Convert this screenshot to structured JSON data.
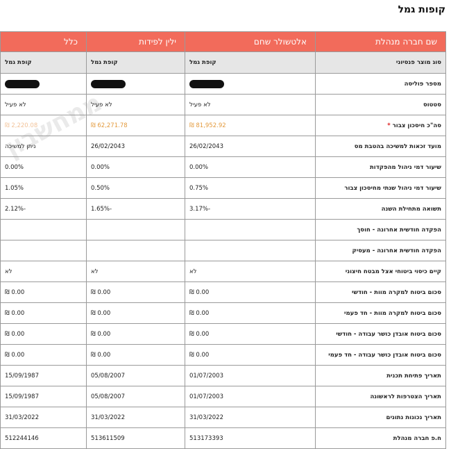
{
  "page_title": "קופות גמל",
  "header": {
    "label_col": "שם חברה מנהלת",
    "col1": "אלטשולר שחם",
    "col2": "ילין לפידות",
    "col3": "כלל"
  },
  "rows": [
    {
      "label": "סוג מוצר פנסיוני",
      "v1": "קופת גמל",
      "v2": "קופת גמל",
      "v3": "קופת גמל"
    },
    {
      "label": "מספר פוליסה",
      "v1": "",
      "v2": "",
      "v3": ""
    },
    {
      "label": "סטטוס",
      "v1": "לא פעיל",
      "v2": "לא פעיל",
      "v3": "לא פעיל"
    },
    {
      "label": "סה\"כ חיסכון צבור",
      "asterisk": "*",
      "v1": "81,952.92 ₪",
      "v2": "62,271.78 ₪",
      "v3": "2,220.08 ₪"
    },
    {
      "label": "מועד זכאות למשיכה בהטבת מס",
      "v1": "26/02/2043",
      "v2": "26/02/2043",
      "v3": "ניתן למשיכה"
    },
    {
      "label": "שיעור דמי ניהול מהפקדות",
      "v1": "0.00%",
      "v2": "0.00%",
      "v3": "0.00%"
    },
    {
      "label": "שיעור דמי ניהול שנתי מחיסכון צבור",
      "v1": "0.75%",
      "v2": "0.50%",
      "v3": "1.05%"
    },
    {
      "label": "תשואה מתחילת השנה",
      "v1": "-3.17%",
      "v2": "-1.65%",
      "v3": "-2.12%"
    },
    {
      "label": "הפקדה חודשית אחרונה - חוסך",
      "v1": "",
      "v2": "",
      "v3": ""
    },
    {
      "label": "הפקדה חודשית אחרונה - מעסיק",
      "v1": "",
      "v2": "",
      "v3": ""
    },
    {
      "label": "קיים כיסוי ביטוחי אצל מבטח חיצוני",
      "v1": "לא",
      "v2": "לא",
      "v3": "לא"
    },
    {
      "label": "סכום ביטוח למקרה מוות - חודשי",
      "v1": "0.00 ₪",
      "v2": "0.00 ₪",
      "v3": "0.00 ₪"
    },
    {
      "label": "סכום ביטוח למקרה מוות - חד פעמי",
      "v1": "0.00 ₪",
      "v2": "0.00 ₪",
      "v3": "0.00 ₪"
    },
    {
      "label": "סכום ביטוח אובדן כושר עבודה - חודשי",
      "v1": "0.00 ₪",
      "v2": "0.00 ₪",
      "v3": "0.00 ₪"
    },
    {
      "label": "סכום ביטוח אובדן כושר עבודה - חד פעמי",
      "v1": "0.00 ₪",
      "v2": "0.00 ₪",
      "v3": "0.00 ₪"
    },
    {
      "label": "תאריך פתיחת תכנית",
      "v1": "01/07/2003",
      "v2": "05/08/2007",
      "v3": "15/09/1987"
    },
    {
      "label": "תאריך הצטרפות לראשונה",
      "v1": "01/07/2003",
      "v2": "05/08/2007",
      "v3": "15/09/1987"
    },
    {
      "label": "תאריך נכונות נתונים",
      "v1": "31/03/2022",
      "v2": "31/03/2022",
      "v3": "31/03/2022"
    },
    {
      "label": "ח.פ חברה מנהלת",
      "v1": "513173393",
      "v2": "513611509",
      "v3": "512244146"
    }
  ],
  "colors": {
    "header_bg": "#f26b5b",
    "accent_orange": "#e39a3d",
    "gray_row": "#e6e6e6"
  }
}
